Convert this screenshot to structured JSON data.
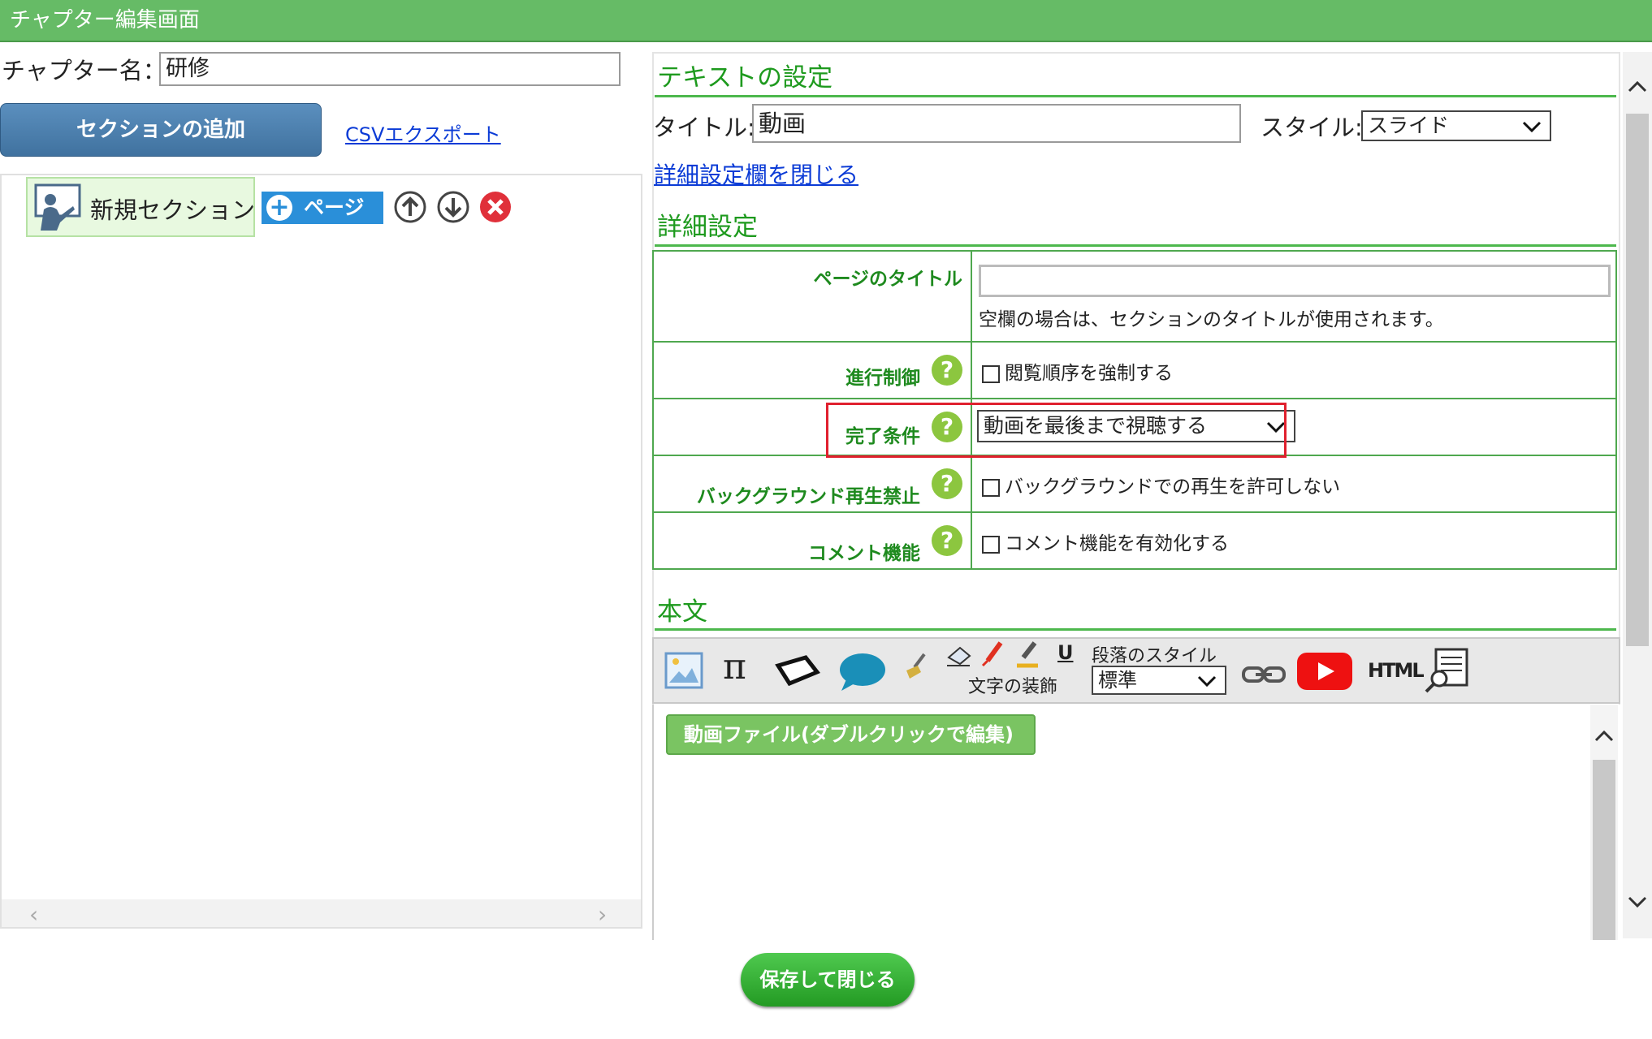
{
  "header": {
    "title": "チャプター編集画面"
  },
  "left": {
    "chapter_label": "チャプター名：",
    "chapter_value": "研修",
    "add_section": "セクションの追加",
    "csv_export": "CSVエクスポート",
    "section_name": "新規セクション",
    "page_button": "ページ"
  },
  "right": {
    "text_settings_heading": "テキストの設定",
    "title_label": "タイトル:",
    "title_value": "動画",
    "style_label": "スタイル:",
    "style_value": "スライド",
    "close_details_link": "詳細設定欄を閉じる",
    "details_heading": "詳細設定",
    "rows": {
      "page_title_label": "ページのタイトル",
      "page_title_value": "",
      "page_title_hint": "空欄の場合は、セクションのタイトルが使用されます。",
      "progress_label": "進行制御",
      "progress_check": "閲覧順序を強制する",
      "completion_label": "完了条件",
      "completion_value": "動画を最後まで視聴する",
      "background_label": "バックグラウンド再生禁止",
      "background_check": "バックグラウンドでの再生を許可しない",
      "comment_label": "コメント機能",
      "comment_check": "コメント機能を有効化する"
    },
    "body_heading": "本文",
    "toolbar": {
      "text_decoration_label": "文字の装飾",
      "paragraph_style_label": "段落のスタイル",
      "paragraph_style_value": "標準",
      "html_label": "HTML"
    },
    "video_block": "動画ファイル(ダブルクリックで編集)",
    "help_mark": "?"
  },
  "footer": {
    "save_close": "保存して閉じる"
  },
  "colors": {
    "header": "#66bb66",
    "accent_green": "#1e9a1e",
    "link": "#0b3bd6",
    "highlight": "#e0202e",
    "primary_button": "#4a7eb0"
  }
}
